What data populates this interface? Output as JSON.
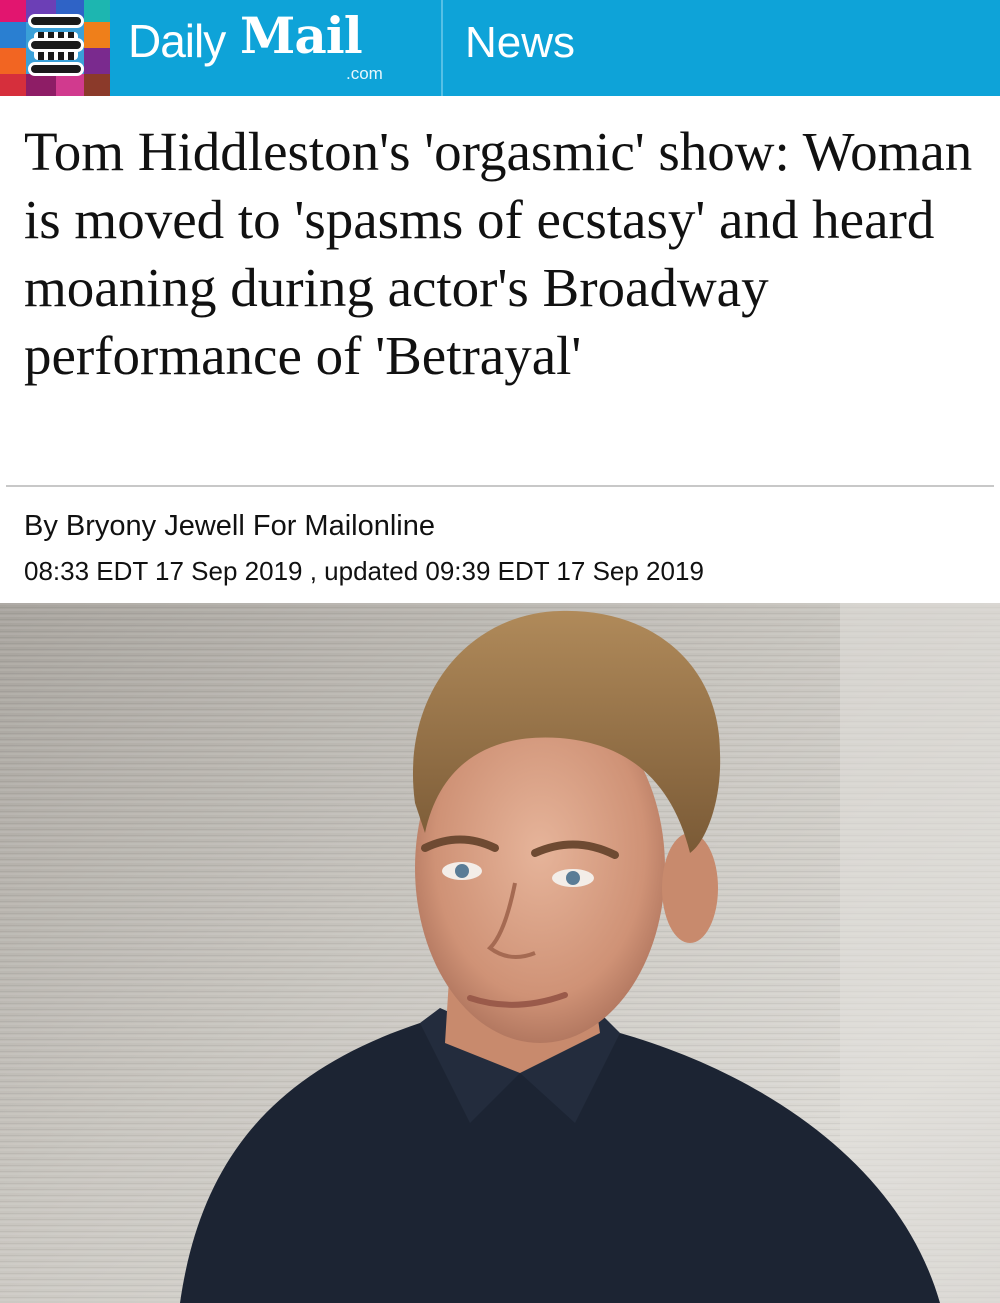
{
  "header": {
    "brand_daily": "Daily",
    "brand_mail": "Mail",
    "brand_domain": ".com",
    "section": "News",
    "menu_icon": "hamburger-menu-icon",
    "bar_color": "#0ea3d8"
  },
  "article": {
    "headline": "Tom Hiddleston's 'orgasmic' show: Woman is moved to 'spasms of ecstasy' and heard moaning during actor's Broadway performance of 'Betrayal'",
    "byline": "By Bryony Jewell For Mailonline",
    "timestamp": "08:33 EDT 17 Sep 2019 , updated 09:39 EDT 17 Sep 2019"
  }
}
